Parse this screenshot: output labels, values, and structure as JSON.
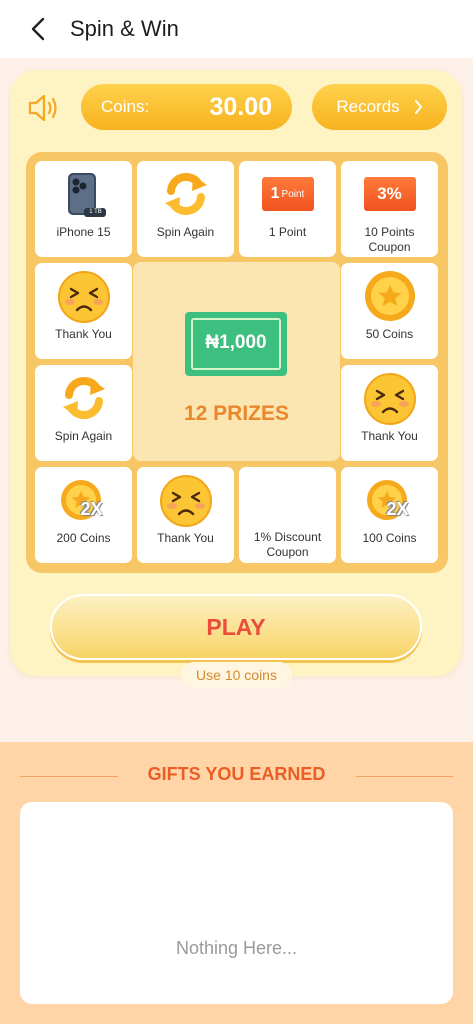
{
  "header": {
    "title": "Spin & Win"
  },
  "coins": {
    "label": "Coins:",
    "value": "30.00"
  },
  "records": {
    "label": "Records"
  },
  "grid": {
    "cells": [
      {
        "label": "iPhone 15",
        "icon": "iphone-icon",
        "badge": "1 TB"
      },
      {
        "label": "Spin Again",
        "icon": "spin-again-icon"
      },
      {
        "label": "1 Point",
        "icon": "point-coupon-icon",
        "badge_num": "1",
        "badge_text": "Point"
      },
      {
        "label": "10 Points Coupon",
        "icon": "percent-coupon-icon",
        "badge": "3%"
      },
      {
        "label": "Thank You",
        "icon": "sad-face-icon"
      },
      {
        "label": "50 Coins",
        "icon": "coin-icon"
      },
      {
        "label": "Spin Again",
        "icon": "spin-again-icon"
      },
      {
        "label": "Thank You",
        "icon": "sad-face-icon"
      },
      {
        "label": "200 Coins",
        "icon": "double-coin-icon",
        "badge": "2X"
      },
      {
        "label": "Thank You",
        "icon": "sad-face-icon"
      },
      {
        "label": "1% Discount Coupon",
        "icon": ""
      },
      {
        "label": "100 Coins",
        "icon": "double-coin-icon",
        "badge": "2X"
      }
    ],
    "center": {
      "prize": "₦1,000",
      "prizes_count": "12 PRIZES"
    }
  },
  "play": {
    "label": "PLAY",
    "cost": "Use 10 coins"
  },
  "gifts": {
    "title": "GIFTS YOU EARNED",
    "empty": "Nothing Here..."
  },
  "colors": {
    "accent": "#f7b21f",
    "play_text": "#ea4d3a",
    "gifts_title": "#ea5d25",
    "prize_text": "#e8872b"
  }
}
